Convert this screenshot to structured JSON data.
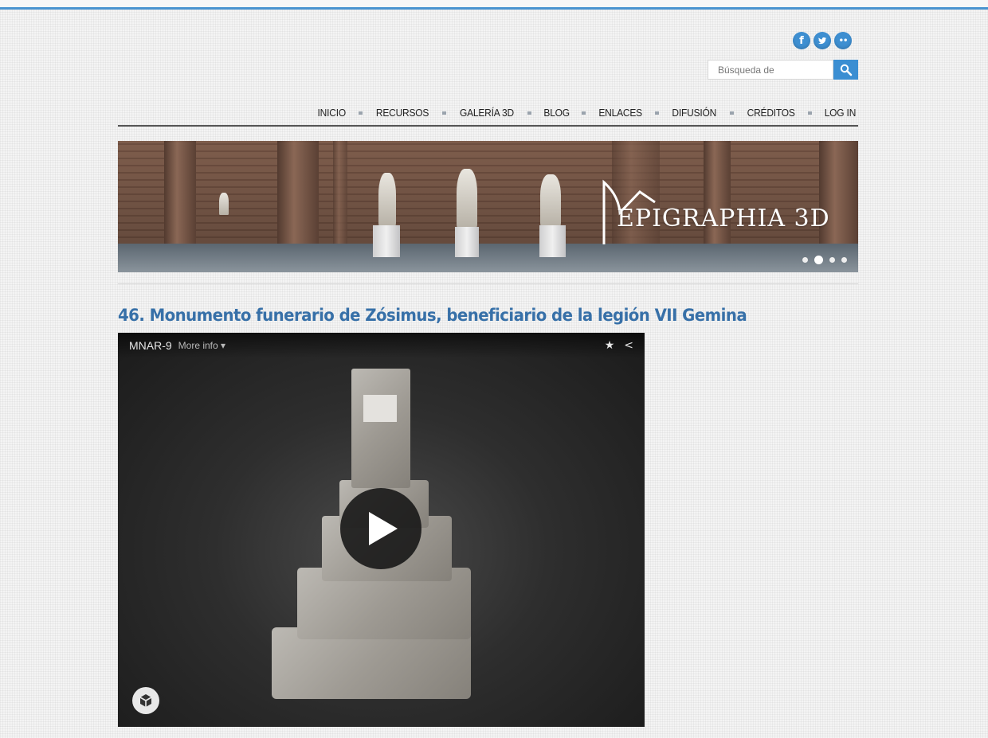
{
  "search": {
    "placeholder": "Búsqueda de"
  },
  "social": [
    {
      "name": "facebook-icon",
      "glyph": "f"
    },
    {
      "name": "twitter-icon",
      "glyph": "t"
    },
    {
      "name": "flickr-icon",
      "glyph": "••"
    }
  ],
  "nav": [
    {
      "label": "INICIO"
    },
    {
      "label": "RECURSOS"
    },
    {
      "label": "GALERÍA 3D"
    },
    {
      "label": "BLOG"
    },
    {
      "label": "ENLACES"
    },
    {
      "label": "DIFUSIÓN"
    },
    {
      "label": "CRÉDITOS"
    },
    {
      "label": "LOG IN"
    }
  ],
  "banner": {
    "logo_text": "EPIGRAPHIA 3D",
    "slides": 4,
    "active_slide": 2
  },
  "post": {
    "title": "46. Monumento funerario de Zósimus, beneficiario de la legión VII Gemina"
  },
  "viewer": {
    "model_title": "MNAR-9",
    "more_info": "More info ▾",
    "star_icon": "★",
    "share_icon": "<"
  },
  "colors": {
    "accent": "#3b8ed2",
    "title": "#3770a8"
  }
}
